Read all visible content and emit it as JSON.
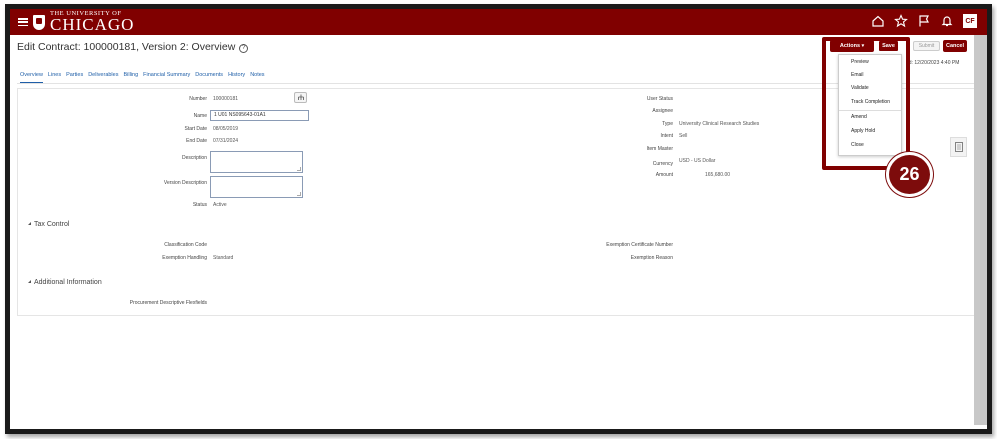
{
  "header": {
    "logo_small": "THE UNIVERSITY OF",
    "logo_big": "CHICAGO",
    "avatar_initials": "CF",
    "brand_color": "#800000",
    "icons": [
      "hamburger-icon",
      "home-icon",
      "favorites-icon",
      "flag-icon",
      "notifications-icon"
    ]
  },
  "page": {
    "title": "Edit Contract: 100000181, Version 2: Overview",
    "last_saved": "ed: 12/20/2023 4:40 PM"
  },
  "buttons": {
    "actions": "Actions",
    "save": "Save",
    "submit": "Submit",
    "cancel": "Cancel"
  },
  "tabs": [
    "Overview",
    "Lines",
    "Parties",
    "Deliverables",
    "Billing",
    "Financial Summary",
    "Documents",
    "History",
    "Notes"
  ],
  "actions_menu": {
    "group1": [
      "Preview",
      "Email",
      "Validate",
      "Track Completion"
    ],
    "group2": [
      "Amend",
      "Apply Hold",
      "Close"
    ]
  },
  "step_badge": "26",
  "left_fields": {
    "number_label": "Number",
    "number_value": "100000181",
    "name_label": "Name",
    "name_value": "1 U01 NS095643-01A1",
    "start_date_label": "Start Date",
    "start_date_value": "08/05/2019",
    "end_date_label": "End Date",
    "end_date_value": "07/31/2024",
    "description_label": "Description",
    "version_description_label": "Version Description",
    "status_label": "Status",
    "status_value": "Active"
  },
  "right_fields": {
    "user_status_label": "User Status",
    "assignee_label": "Assignee",
    "type_label": "Type",
    "type_value": "University Clinical Research Studies",
    "intent_label": "Intent",
    "intent_value": "Sell",
    "item_master_label": "Item Master",
    "currency_label": "Currency",
    "currency_value": "USD - US Dollar",
    "amount_label": "Amount",
    "amount_value": "165,680.00"
  },
  "tax_control": {
    "title": "Tax Control",
    "classification_code_label": "Classification Code",
    "exemption_handling_label": "Exemption Handling",
    "exemption_handling_value": "Standard",
    "exemption_certificate_label": "Exemption Certificate Number",
    "exemption_reason_label": "Exemption Reason"
  },
  "additional_info": {
    "title": "Additional Information",
    "flexfields_label": "Procurement Descriptive Flexfields"
  }
}
